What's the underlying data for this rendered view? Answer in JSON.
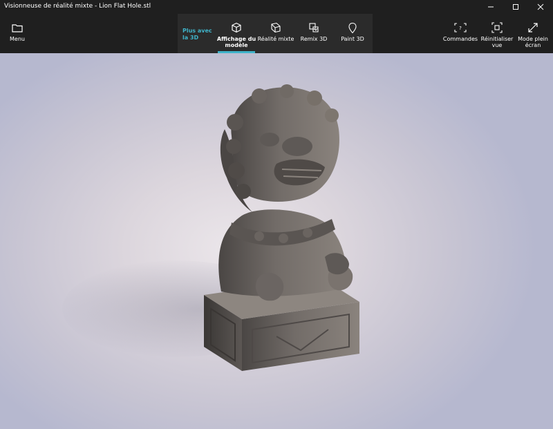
{
  "window": {
    "title": "Visionneuse de réalité mixte - Lion Flat Hole.stl"
  },
  "toolbar": {
    "menu_label": "Menu",
    "group_label": "Plus avec\nla 3D",
    "tabs": [
      {
        "label": "Affichage du\nmodèle",
        "icon": "cube-icon",
        "active": true
      },
      {
        "label": "Réalité mixte",
        "icon": "mixed-reality-icon",
        "active": false
      },
      {
        "label": "Remix 3D",
        "icon": "remix-3d-icon",
        "active": false
      },
      {
        "label": "Paint 3D",
        "icon": "paint-3d-icon",
        "active": false
      }
    ],
    "right": [
      {
        "label": "Commandes",
        "icon": "commands-icon"
      },
      {
        "label": "Réinitialiser\nvue",
        "icon": "reset-view-icon"
      },
      {
        "label": "Mode plein\nécran",
        "icon": "fullscreen-icon"
      }
    ]
  },
  "colors": {
    "chrome": "#1f1f1f",
    "group_bg": "#2b2b2b",
    "accent": "#3fb3c9",
    "model": "#6f6a66"
  }
}
